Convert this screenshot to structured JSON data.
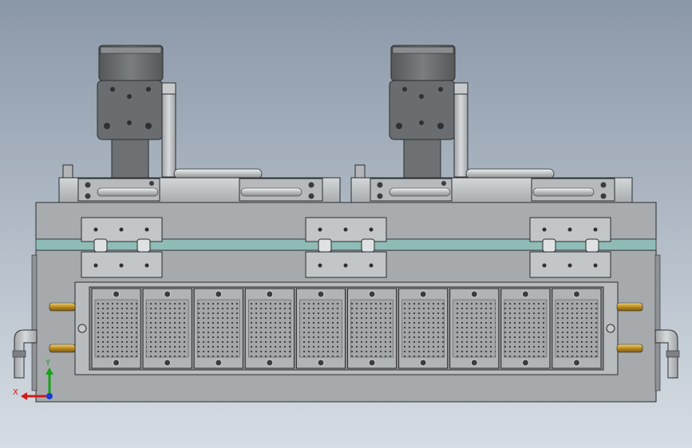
{
  "viewport": {
    "background_top": "#8b98a8",
    "background_bottom": "#d6dde4"
  },
  "colors": {
    "steel_light": "#c9ccce",
    "steel_mid": "#a9adb0",
    "steel_dark": "#7d8185",
    "motor_body": "#6b6e70",
    "motor_dark": "#4b4e50",
    "bracket_plate": "#bcbfc1",
    "teal_band": "#8fbcb6",
    "brass_fitting": "#c9a23a",
    "axis_x": "#d11a1a",
    "axis_y": "#19a119",
    "axis_z": "#1a3ad1",
    "outline": "#2b2d2f"
  },
  "icons": {
    "stepper_motor": "stepper-motor-icon",
    "air_fitting": "air-fitting-icon",
    "elbow_fitting": "elbow-fitting-icon",
    "triad": "coordinate-triad-icon"
  },
  "triad": {
    "x_label": "X",
    "y_label": "Y"
  },
  "layout_counts": {
    "tray_modules": 10,
    "motors": 2,
    "hinge_brackets": 3
  }
}
